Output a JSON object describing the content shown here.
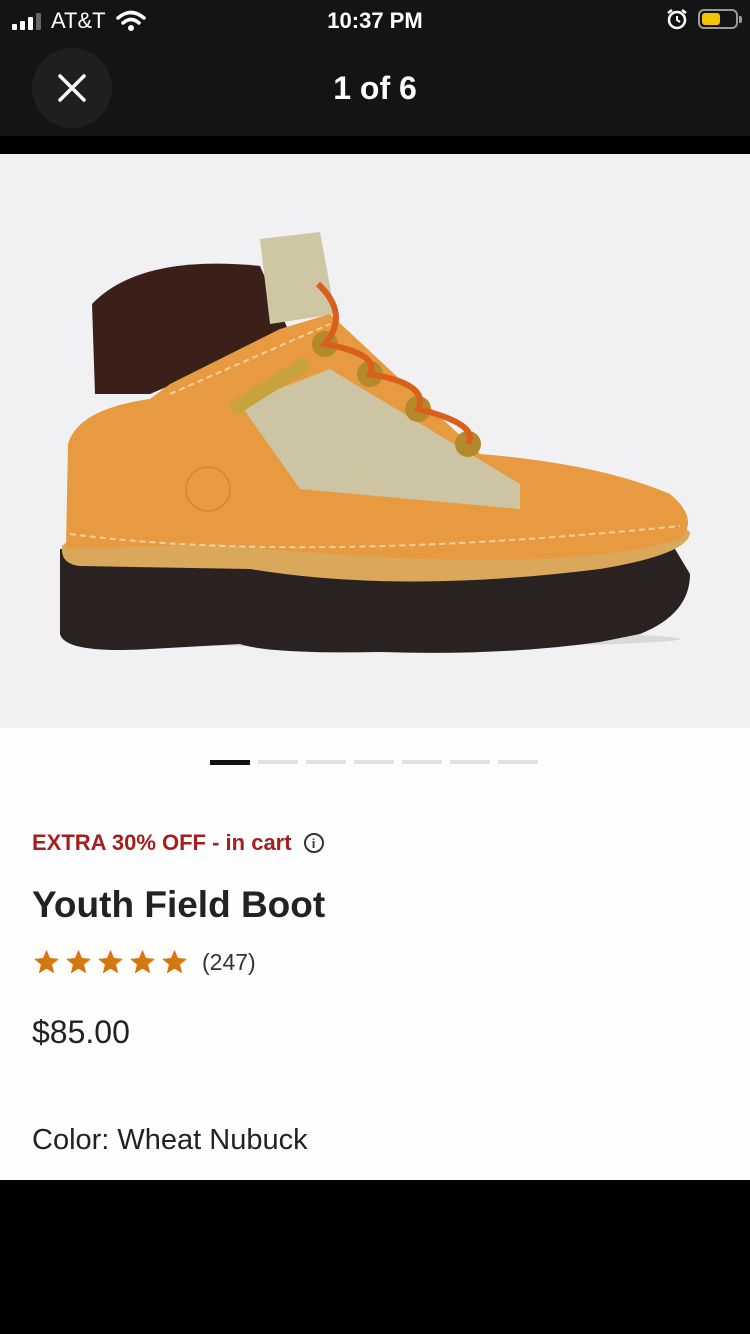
{
  "status_bar": {
    "carrier": "AT&T",
    "time": "10:37 PM"
  },
  "nav": {
    "counter": "1 of 6"
  },
  "gallery": {
    "dot_count": 7,
    "active_index": 0,
    "image_icon": "boot-image"
  },
  "product": {
    "promo": "EXTRA 30% OFF - in cart",
    "name": "Youth Field Boot",
    "rating_stars": 5,
    "review_count": "(247)",
    "price": "$85.00",
    "color": "Color: Wheat Nubuck"
  },
  "colors": {
    "promo": "#a51f1f",
    "star": "#d4770f",
    "battery": "#f5c400"
  }
}
